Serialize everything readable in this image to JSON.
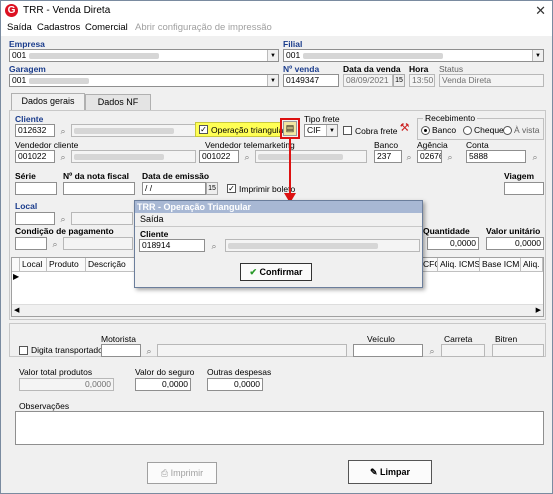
{
  "window": {
    "title": "TRR - Venda Direta",
    "close_glyph": "✕"
  },
  "menu": {
    "items": [
      "Saída",
      "Cadastros",
      "Comercial"
    ],
    "disabled_item": "Abrir configuração de impressão"
  },
  "header": {
    "empresa_label": "Empresa",
    "empresa_value": "001",
    "filial_label": "Filial",
    "filial_value": "001",
    "garagem_label": "Garagem",
    "garagem_value": "001",
    "nvenda_label": "Nº venda",
    "nvenda_value": "0149347",
    "data_venda_label": "Data da venda",
    "data_venda_value": "08/09/2021",
    "hora_label": "Hora",
    "hora_value": "13:50",
    "status_label": "Status",
    "status_value": "Venda Direta"
  },
  "tabs": [
    "Dados gerais",
    "Dados NF"
  ],
  "dados_gerais": {
    "cliente_label": "Cliente",
    "cliente_value": "012632",
    "operacao_triangular_label": "Operação triangular",
    "tipo_frete_label": "Tipo frete",
    "tipo_frete_value": "CIF",
    "cobra_frete_label": "Cobra frete",
    "recebimento_label": "Recebimento",
    "recebimento_options": [
      "Banco",
      "Cheque",
      "À vista"
    ],
    "recebimento_selected": "Banco",
    "vendedor_cliente_label": "Vendedor cliente",
    "vendedor_cliente_value": "001022",
    "vendedor_tele_label": "Vendedor telemarketing",
    "vendedor_tele_value": "001022",
    "banco_label": "Banco",
    "banco_value": "237",
    "agencia_label": "Agência",
    "agencia_value": "02676",
    "conta_label": "Conta",
    "conta_value": "5888",
    "serie_label": "Série",
    "nota_fiscal_label": "Nº da nota fiscal",
    "data_emissao_label": "Data de emissão",
    "data_emissao_value": " / /",
    "imprimir_boleto_label": "Imprimir boleto",
    "viagem_label": "Viagem",
    "local_label": "Local",
    "condicao_label": "Condição de pagamento",
    "quantidade_label": "Quantidade",
    "quantidade_value": "0,0000",
    "valor_unitario_label": "Valor unitário",
    "valor_unitario_value": "0,0000"
  },
  "grid": {
    "columns": [
      "Local",
      "Produto",
      "Descrição"
    ],
    "right_columns": [
      "CFOP",
      "Aliq. ICMS",
      "Base ICMS",
      "Aliq. ic"
    ]
  },
  "bottom": {
    "digita_transportador_label": "Digita transportador",
    "motorista_label": "Motorista",
    "veiculo_label": "Veículo",
    "carreta_label": "Carreta",
    "bitren_label": "Bitren",
    "valor_total_label": "Valor total produtos",
    "valor_total_value": "0,0000",
    "valor_seguro_label": "Valor do seguro",
    "valor_seguro_value": "0,0000",
    "outras_despesas_label": "Outras despesas",
    "outras_despesas_value": "0,0000",
    "observacoes_label": "Observações"
  },
  "buttons": {
    "imprimir": "Imprimir",
    "limpar": "Limpar"
  },
  "dialog": {
    "title": "TRR - Operação Triangular",
    "menu": "Saída",
    "cliente_label": "Cliente",
    "cliente_value": "018914",
    "confirm": "Confirmar"
  },
  "colors": {
    "accent_label": "#1a3c8c",
    "highlight": "#ffff55",
    "annotation": "#dd1111"
  }
}
